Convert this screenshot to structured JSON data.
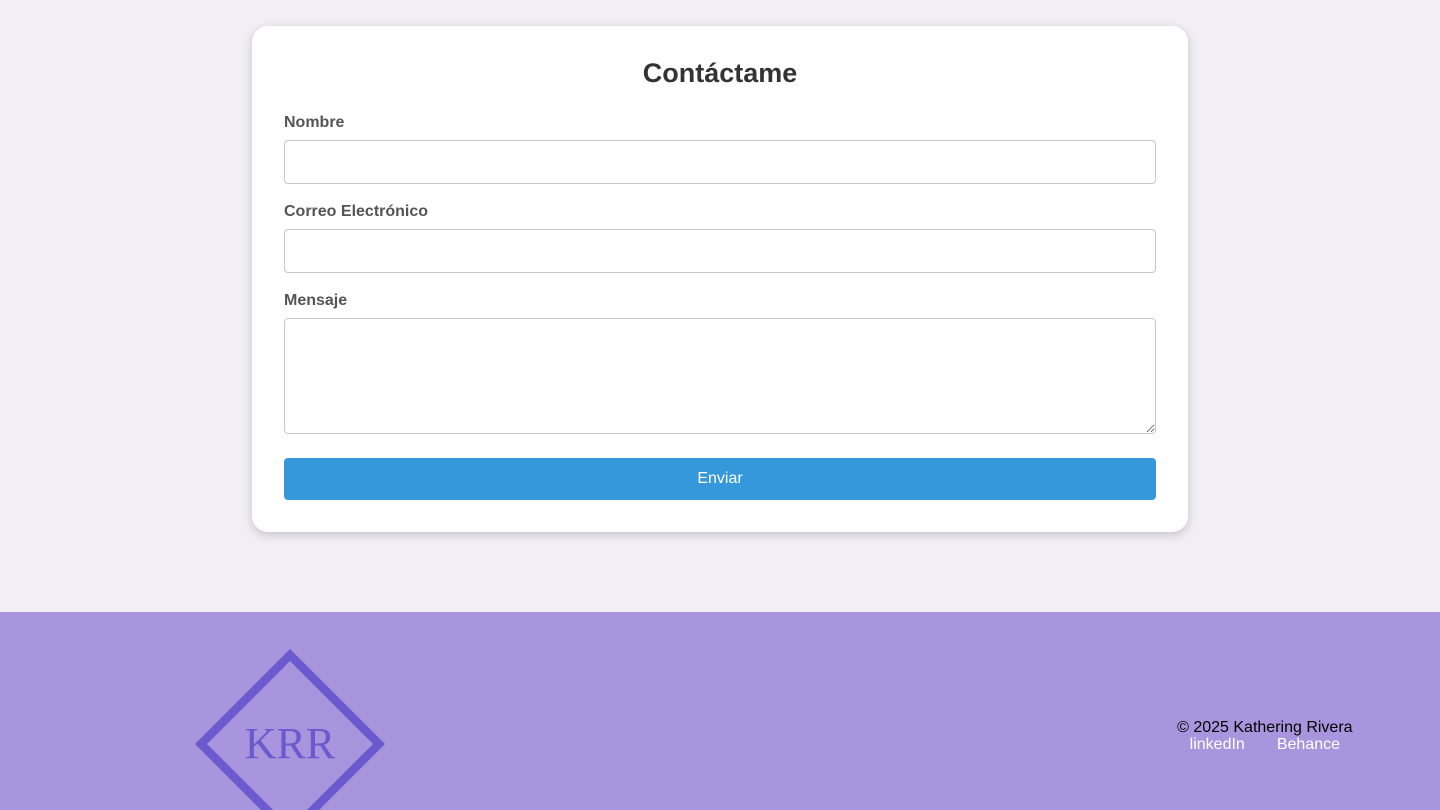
{
  "form": {
    "title": "Contáctame",
    "name_label": "Nombre",
    "name_value": "",
    "email_label": "Correo Electrónico",
    "email_value": "",
    "message_label": "Mensaje",
    "message_value": "",
    "submit_label": "Enviar"
  },
  "footer": {
    "logo_text": "KRR",
    "copyright": "© 2025 Kathering Rivera",
    "links": [
      "linkedIn",
      "Behance"
    ]
  },
  "colors": {
    "background": "#f1eff5",
    "footer_bg": "#a995de",
    "button_bg": "#3498db",
    "logo": "#6a5acd"
  }
}
